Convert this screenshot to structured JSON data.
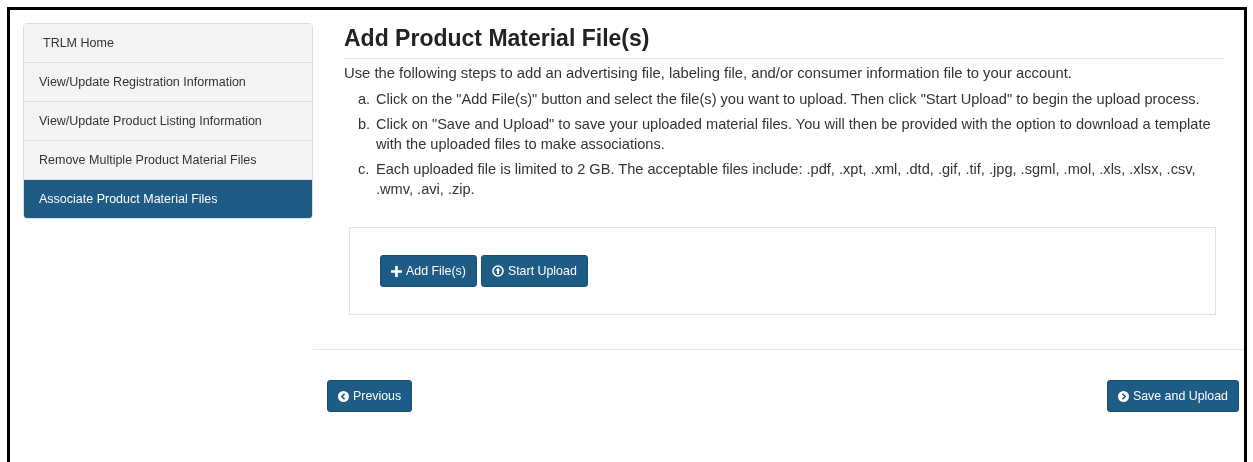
{
  "sidebar": {
    "items": [
      {
        "label": "TRLM Home",
        "selected": false
      },
      {
        "label": "View/Update Registration Information",
        "selected": false
      },
      {
        "label": "View/Update Product Listing Information",
        "selected": false
      },
      {
        "label": "Remove Multiple Product Material Files",
        "selected": false
      },
      {
        "label": "Associate Product Material Files",
        "selected": true
      }
    ]
  },
  "title": "Add Product Material File(s)",
  "intro": "Use the following steps to add an advertising file, labeling file, and/or consumer information file to your account.",
  "steps": [
    {
      "marker": "a.",
      "text": "Click on the \"Add File(s)\" button and select the file(s) you want to upload. Then click \"Start Upload\" to begin the upload process."
    },
    {
      "marker": "b.",
      "text": "Click on \"Save and Upload\" to save your uploaded material files. You will then be provided with the option to download a template with the uploaded files to make associations."
    },
    {
      "marker": "c.",
      "text": "Each uploaded file is limited to 2 GB. The acceptable files include: .pdf, .xpt, .xml, .dtd, .gif, .tif, .jpg, .sgml, .mol, .xls, .xlsx, .csv, .wmv, .avi, .zip."
    }
  ],
  "upload_buttons": [
    {
      "label": "Add File(s)"
    },
    {
      "label": "Start Upload"
    }
  ],
  "footer_buttons": [
    {
      "label": "Previous"
    },
    {
      "label": "Save and Upload"
    }
  ]
}
